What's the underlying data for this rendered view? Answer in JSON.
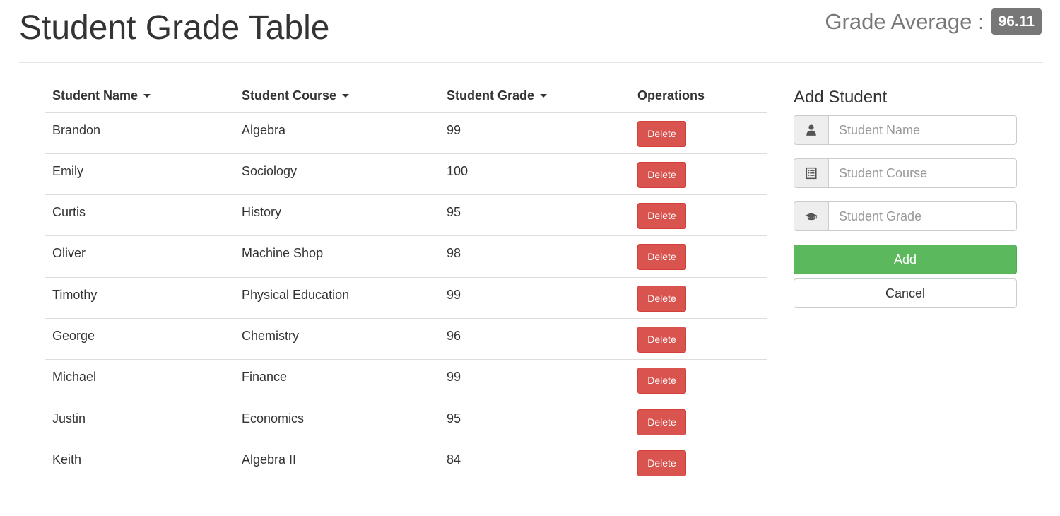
{
  "header": {
    "title": "Student Grade Table",
    "average_label": "Grade Average :",
    "average_value": "96.11"
  },
  "table": {
    "columns": [
      {
        "label": "Student Name",
        "sortable": true
      },
      {
        "label": "Student Course",
        "sortable": true
      },
      {
        "label": "Student Grade",
        "sortable": true
      },
      {
        "label": "Operations",
        "sortable": false
      }
    ],
    "delete_label": "Delete",
    "rows": [
      {
        "name": "Brandon",
        "course": "Algebra",
        "grade": "99"
      },
      {
        "name": "Emily",
        "course": "Sociology",
        "grade": "100"
      },
      {
        "name": "Curtis",
        "course": "History",
        "grade": "95"
      },
      {
        "name": "Oliver",
        "course": "Machine Shop",
        "grade": "98"
      },
      {
        "name": "Timothy",
        "course": "Physical Education",
        "grade": "99"
      },
      {
        "name": "George",
        "course": "Chemistry",
        "grade": "96"
      },
      {
        "name": "Michael",
        "course": "Finance",
        "grade": "99"
      },
      {
        "name": "Justin",
        "course": "Economics",
        "grade": "95"
      },
      {
        "name": "Keith",
        "course": "Algebra II",
        "grade": "84"
      }
    ]
  },
  "add_form": {
    "title": "Add Student",
    "name_placeholder": "Student Name",
    "course_placeholder": "Student Course",
    "grade_placeholder": "Student Grade",
    "name_icon": "user-icon",
    "course_icon": "list-alt-icon",
    "grade_icon": "education-cap-icon",
    "add_label": "Add",
    "cancel_label": "Cancel"
  },
  "colors": {
    "danger": "#d9534f",
    "success": "#5cb85c",
    "badge": "#777777"
  }
}
